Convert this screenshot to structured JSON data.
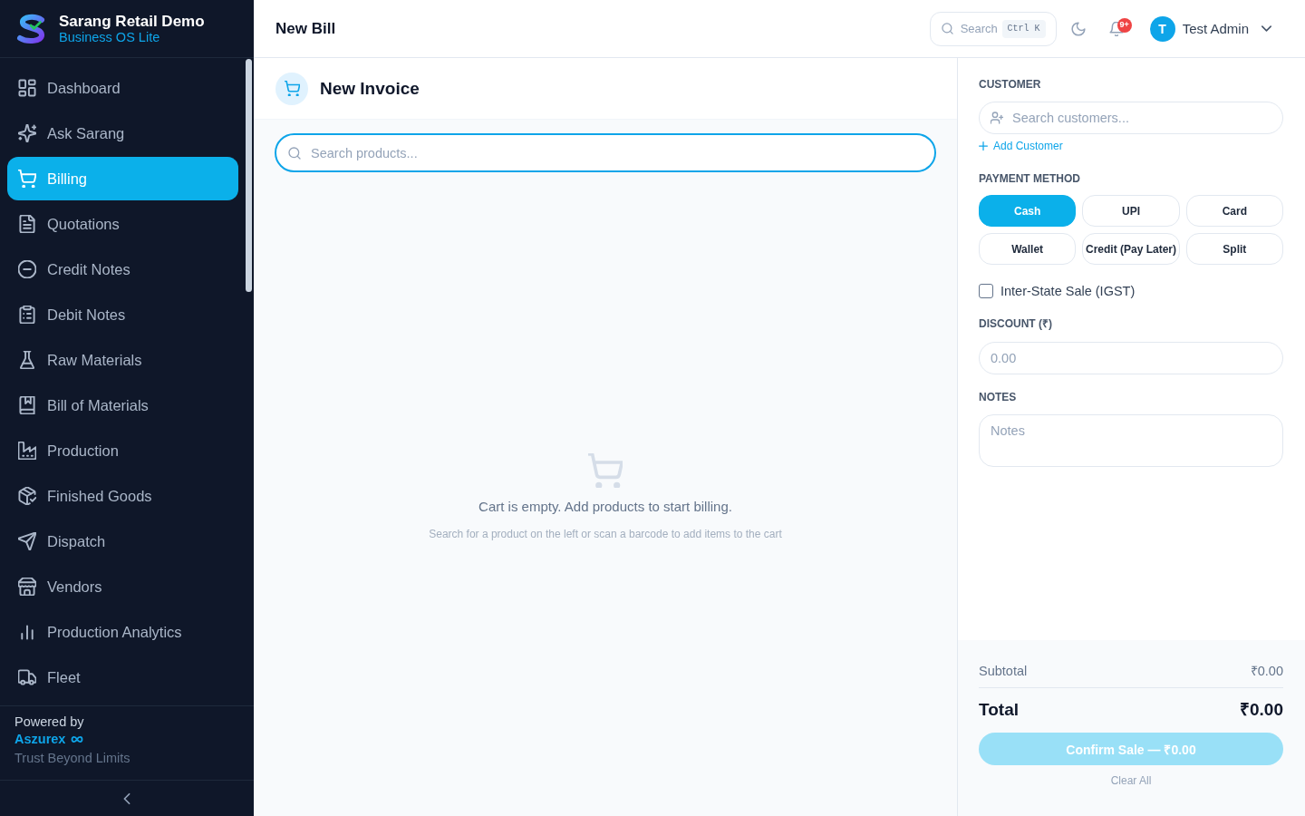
{
  "brand": {
    "title": "Sarang Retail Demo",
    "subtitle": "Business OS Lite"
  },
  "sidebar": {
    "items": [
      {
        "label": "Dashboard",
        "selected": false
      },
      {
        "label": "Ask Sarang",
        "selected": false
      },
      {
        "label": "Billing",
        "selected": true
      },
      {
        "label": "Quotations",
        "selected": false
      },
      {
        "label": "Credit Notes",
        "selected": false
      },
      {
        "label": "Debit Notes",
        "selected": false
      },
      {
        "label": "Raw Materials",
        "selected": false
      },
      {
        "label": "Bill of Materials",
        "selected": false
      },
      {
        "label": "Production",
        "selected": false
      },
      {
        "label": "Finished Goods",
        "selected": false
      },
      {
        "label": "Dispatch",
        "selected": false
      },
      {
        "label": "Vendors",
        "selected": false
      },
      {
        "label": "Production Analytics",
        "selected": false
      },
      {
        "label": "Fleet",
        "selected": false
      }
    ],
    "footer": {
      "powered_by": "Powered by",
      "company": "Aszurex",
      "tagline": "Trust Beyond Limits"
    }
  },
  "top_bar": {
    "title": "New Bill",
    "search": {
      "placeholder": "Search",
      "shortcut": "Ctrl K"
    },
    "notifications": {
      "badge": "9+"
    },
    "user": {
      "initial": "T",
      "name": "Test Admin"
    }
  },
  "invoice": {
    "title": "New Invoice",
    "product_search": {
      "placeholder": "Search products..."
    },
    "empty_state": {
      "message": "Cart is empty. Add products to start billing.",
      "hint": "Search for a product on the left or scan a barcode to add items to the cart"
    }
  },
  "checkout": {
    "customer": {
      "label": "CUSTOMER",
      "placeholder": "Search customers...",
      "add_link": "Add Customer"
    },
    "payment": {
      "label": "PAYMENT METHOD",
      "methods": [
        {
          "label": "Cash",
          "selected": true
        },
        {
          "label": "UPI",
          "selected": false
        },
        {
          "label": "Card",
          "selected": false
        },
        {
          "label": "Wallet",
          "selected": false
        },
        {
          "label": "Credit (Pay Later)",
          "selected": false
        },
        {
          "label": "Split",
          "selected": false
        }
      ]
    },
    "inter_state": {
      "label": "Inter-State Sale (IGST)",
      "checked": false
    },
    "discount": {
      "label": "DISCOUNT (₹)",
      "placeholder": "0.00"
    },
    "notes": {
      "label": "NOTES",
      "placeholder": "Notes"
    },
    "summary": {
      "subtotal_label": "Subtotal",
      "subtotal": "₹0.00",
      "total_label": "Total",
      "total": "₹0.00"
    },
    "confirm_button": {
      "label": "Confirm Sale — ₹0.00",
      "disabled": true
    },
    "clear_button": "Clear All"
  }
}
